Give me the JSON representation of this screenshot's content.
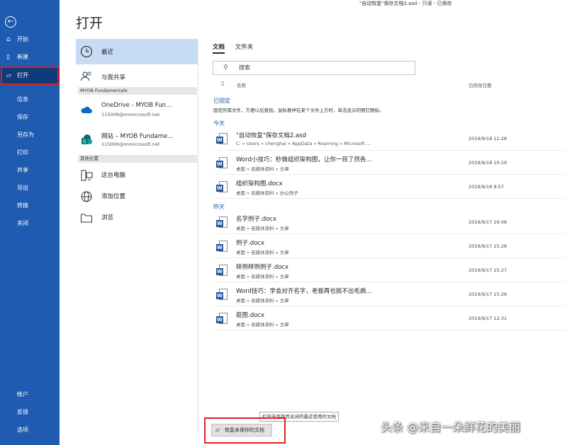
{
  "titlebar": "\"自动恢复\"保存文档2.asd  -  只读  -  已保存",
  "page_title": "打开",
  "nav": {
    "top": [
      {
        "label": "开始",
        "icon": "home-icon"
      },
      {
        "label": "新建",
        "icon": "new-doc-icon"
      },
      {
        "label": "打开",
        "icon": "open-folder-icon"
      }
    ],
    "middle": [
      "信息",
      "保存",
      "另存为",
      "打印",
      "共享",
      "导出",
      "转换",
      "关闭"
    ],
    "bottom": [
      "帐户",
      "反馈",
      "选项"
    ]
  },
  "locations": {
    "recent": "最近",
    "shared": "与我共享",
    "section_myob": "MYOB Fundamentals",
    "onedrive_name": "OneDrive - MYOB Fun...",
    "onedrive_email": "115009@onmicrosoft.net",
    "site_name": "网站 – MYOB Fundame...",
    "site_email": "115009@onmicrosoft.net",
    "section_other": "其他位置",
    "this_pc": "这台电脑",
    "add_place": "添加位置",
    "browse": "浏览"
  },
  "tabs": [
    "文档",
    "文件夹"
  ],
  "search_placeholder": "搜索",
  "columns": {
    "name": "名称",
    "date": "已修改日期"
  },
  "pinned": {
    "title": "已固定",
    "desc": "固定所需文件，方便以后查找。鼠标悬停在某个文件上方时，单击显示的图钉图标。"
  },
  "today_label": "今天",
  "yesterday_label": "昨天",
  "files_today": [
    {
      "name": "\"自动恢复\"保存文档2.asd",
      "path": "C: » Users » chenghai » AppData » Roaming » Microsoft ...",
      "date": "2019/9/18 11:28"
    },
    {
      "name": "Word小技巧：秒做组织架构图，让你一目了然各...",
      "path": "桌面 » 自媒体资料 » 文章",
      "date": "2019/9/18 10:19"
    },
    {
      "name": "组织架构图.docx",
      "path": "桌面 » 自媒体资料 » 办公例子",
      "date": "2019/9/18 9:57"
    }
  ],
  "files_yesterday": [
    {
      "name": "名字例子.docx",
      "path": "桌面 » 自媒体资料 » 文章",
      "date": "2019/9/17 16:08"
    },
    {
      "name": "例子.docx",
      "path": "桌面 » 自媒体资料 » 文章",
      "date": "2019/9/17 15:28"
    },
    {
      "name": "样例样例例子.docx",
      "path": "桌面 » 自媒体资料 » 文章",
      "date": "2019/9/17 15:27"
    },
    {
      "name": "Word技巧：学会对齐名字，老板再也挑不出毛病...",
      "path": "桌面 » 自媒体资料 » 文章",
      "date": "2019/9/17 15:26"
    },
    {
      "name": "抠图.docx",
      "path": "桌面 » 自媒体资料 » 文章",
      "date": "2019/9/17 12:31"
    }
  ],
  "tooltip": "打开未保存而关闭的最近使用的文档",
  "recover_button": "恢复未保存的文档",
  "watermark": "头条 @来自一朵鲜花的美丽",
  "colors": {
    "nav_bg": "#1f5bb0",
    "accent": "#1f5bb0",
    "highlight_border": "#e02020",
    "selected_location": "#c7dcf4"
  }
}
